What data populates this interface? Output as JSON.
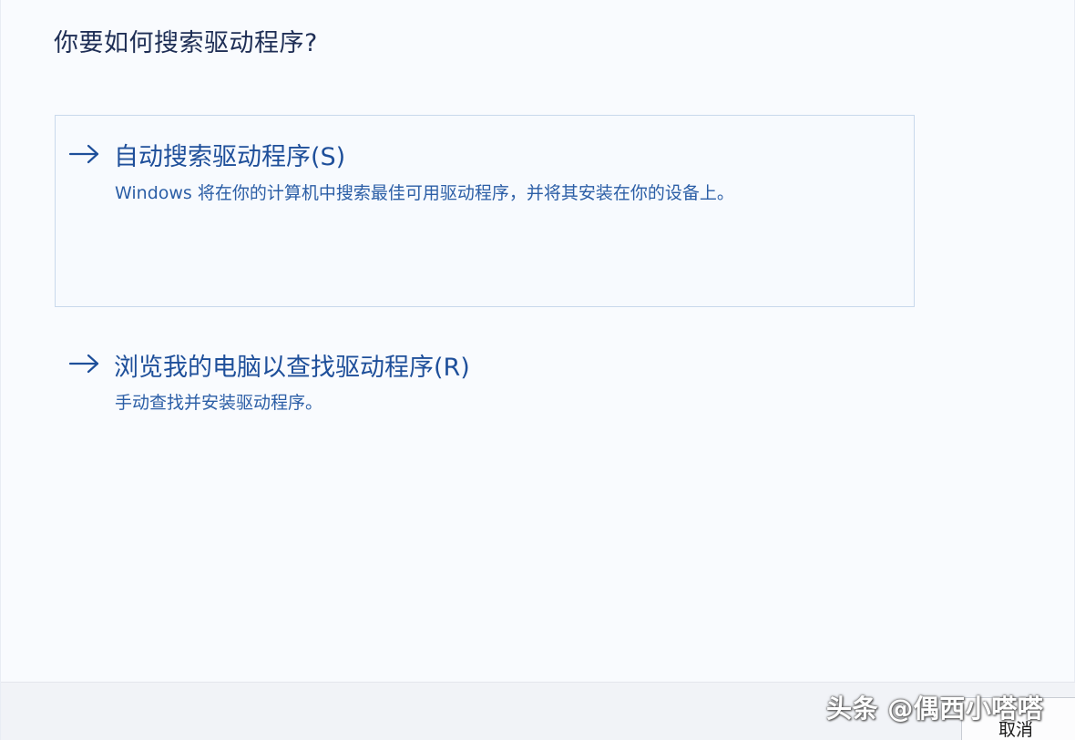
{
  "dialog": {
    "title": "你要如何搜索驱动程序?"
  },
  "options": [
    {
      "heading": "自动搜索驱动程序(S)",
      "description": "Windows 将在你的计算机中搜索最佳可用驱动程序，并将其安装在你的设备上。",
      "icon": "arrow-right-icon"
    },
    {
      "heading": "浏览我的电脑以查找驱动程序(R)",
      "description": "手动查找并安装驱动程序。",
      "icon": "arrow-right-icon"
    }
  ],
  "footer": {
    "cancel_label": "取消"
  },
  "watermark": {
    "text": "头条 @偶西小嗒嗒"
  },
  "colors": {
    "accent": "#1e4f9a",
    "title": "#1e2e55",
    "selected_border": "#c9d9ec"
  }
}
